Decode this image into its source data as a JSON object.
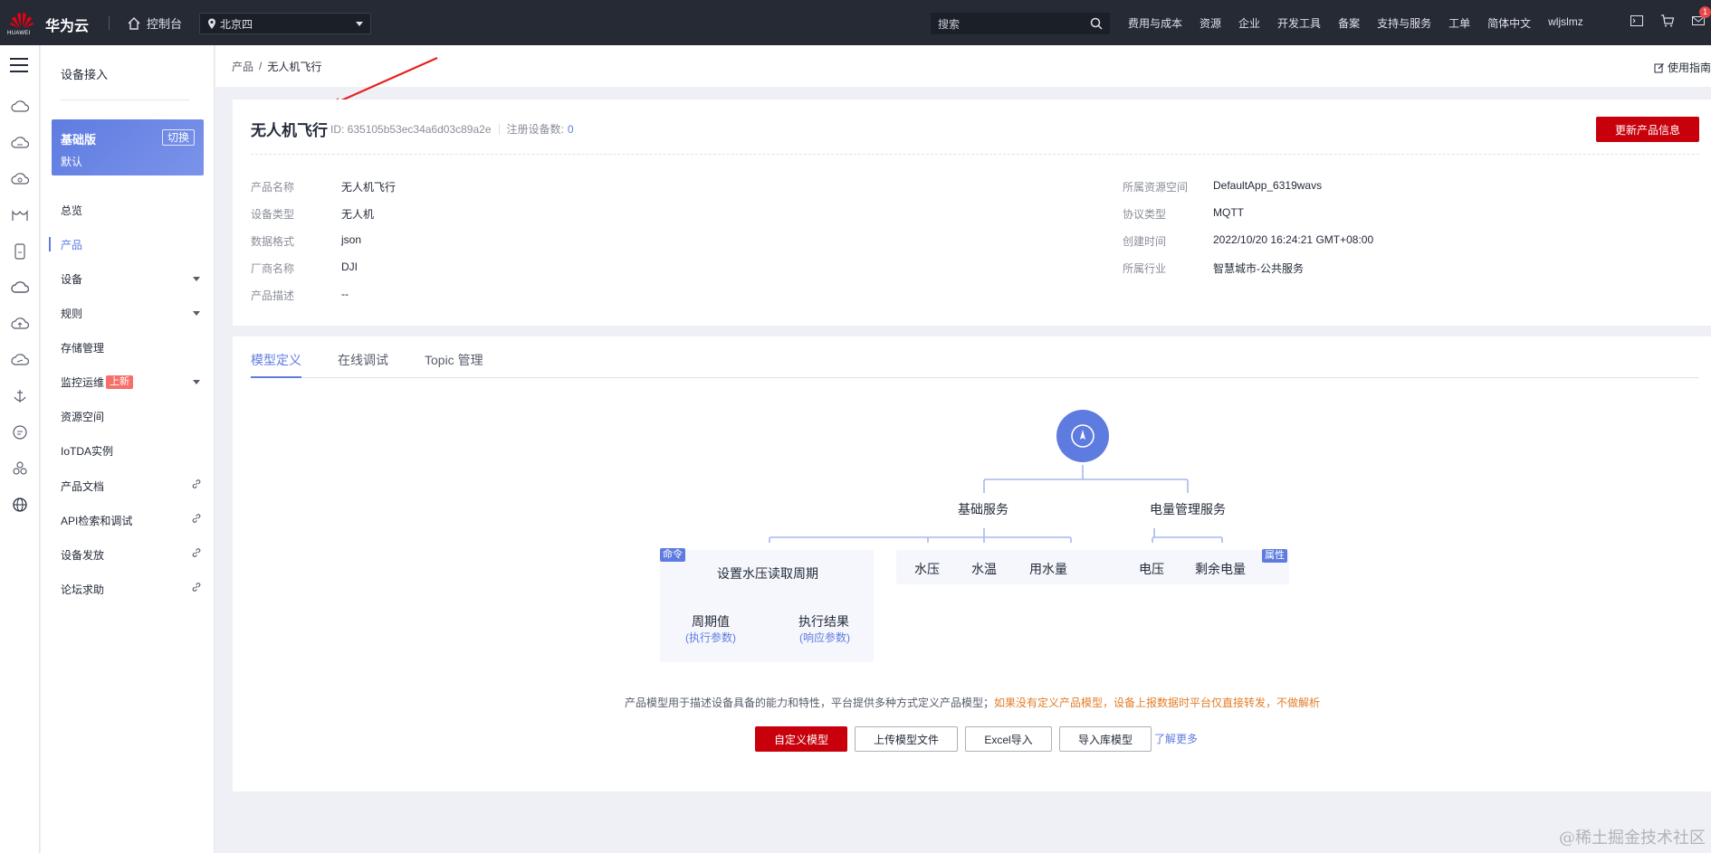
{
  "topbar": {
    "logo_text": "HUAWEI",
    "brand": "华为云",
    "console": "控制台",
    "region": "北京四",
    "search_placeholder": "搜索",
    "nav": [
      "费用与成本",
      "资源",
      "企业",
      "开发工具",
      "备案",
      "支持与服务",
      "工单",
      "简体中文",
      "wljslmz"
    ],
    "notification_count": "1"
  },
  "sidebar": {
    "title": "设备接入",
    "edition": {
      "name": "基础版",
      "switch": "切换",
      "sub": "默认"
    },
    "items": [
      {
        "label": "总览"
      },
      {
        "label": "产品"
      },
      {
        "label": "设备"
      },
      {
        "label": "规则"
      },
      {
        "label": "存储管理"
      },
      {
        "label": "监控运维",
        "tag": "上新"
      },
      {
        "label": "资源空间"
      },
      {
        "label": "IoTDA实例"
      },
      {
        "label": "产品文档"
      },
      {
        "label": "API检索和调试"
      },
      {
        "label": "设备发放"
      },
      {
        "label": "论坛求助"
      }
    ]
  },
  "breadcrumb": {
    "parent": "产品",
    "separator": "/",
    "current": "无人机飞行",
    "guide": "使用指南"
  },
  "product": {
    "name": "无人机飞行",
    "id_text": "ID: 635105b53ec34a6d03c89a2e",
    "registered_label": "注册设备数:",
    "registered_count": "0",
    "update_button": "更新产品信息",
    "left_fields": [
      {
        "key": "产品名称",
        "value": "无人机飞行"
      },
      {
        "key": "设备类型",
        "value": "无人机"
      },
      {
        "key": "数据格式",
        "value": "json"
      },
      {
        "key": "厂商名称",
        "value": "DJI"
      },
      {
        "key": "产品描述",
        "value": "--"
      }
    ],
    "right_fields": [
      {
        "key": "所属资源空间",
        "value": "DefaultApp_6319wavs"
      },
      {
        "key": "协议类型",
        "value": "MQTT"
      },
      {
        "key": "创建时间",
        "value": "2022/10/20 16:24:21 GMT+08:00"
      },
      {
        "key": "所属行业",
        "value": "智慧城市-公共服务"
      }
    ]
  },
  "tabs": [
    "模型定义",
    "在线调试",
    "Topic 管理"
  ],
  "diagram": {
    "services": [
      "基础服务",
      "电量管理服务"
    ],
    "command_tag": "命令",
    "command": "设置水压读取周期",
    "params": [
      {
        "name": "周期值",
        "sub": "(执行参数)"
      },
      {
        "name": "执行结果",
        "sub": "(响应参数)"
      }
    ],
    "property_tag": "属性",
    "properties": [
      "水压",
      "水温",
      "用水量",
      "电压",
      "剩余电量"
    ]
  },
  "note": {
    "text": "产品模型用于描述设备具备的能力和特性，平台提供多种方式定义产品模型；",
    "warning": "如果没有定义产品模型，设备上报数据时平台仅直接转发，不做解析"
  },
  "actions": {
    "custom": "自定义模型",
    "upload": "上传模型文件",
    "excel": "Excel导入",
    "library": "导入库模型",
    "learn_more": "了解更多"
  },
  "watermark": "@稀土掘金技术社区",
  "colors": {
    "brand_red": "#c7000b",
    "accent": "#5e7ce0",
    "topbar_bg": "#252a35",
    "warning": "#e37d29"
  }
}
